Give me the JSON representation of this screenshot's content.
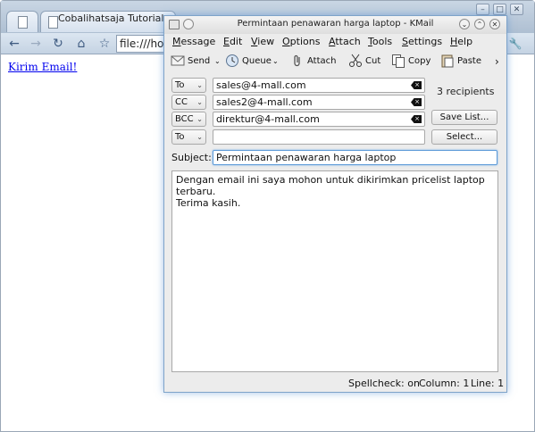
{
  "browser": {
    "tabs": [
      {
        "label": ""
      },
      {
        "label": "Cobalihatsaja Tutorial"
      }
    ],
    "url": "file:///hom",
    "page_link": "Kirim Email!"
  },
  "kmail": {
    "title": "Permintaan penawaran harga laptop - KMail",
    "menu": [
      "Message",
      "Edit",
      "View",
      "Options",
      "Attach",
      "Tools",
      "Settings",
      "Help"
    ],
    "toolbar": {
      "send": "Send",
      "queue": "Queue",
      "attach": "Attach",
      "cut": "Cut",
      "copy": "Copy",
      "paste": "Paste",
      "more": "›"
    },
    "recipients": [
      {
        "type": "To",
        "address": "sales@4-mall.com"
      },
      {
        "type": "CC",
        "address": "sales2@4-mall.com"
      },
      {
        "type": "BCC",
        "address": "direktur@4-mall.com"
      },
      {
        "type": "To",
        "address": ""
      }
    ],
    "recipients_count": "3 recipients",
    "save_list_label": "Save List...",
    "select_label": "Select...",
    "subject_label": "Subject:",
    "subject": "Permintaan penawaran harga laptop",
    "body_line1": "Dengan email ini saya mohon untuk dikirimkan pricelist laptop terbaru.",
    "body_line2": "Terima kasih.",
    "status": {
      "spellcheck": "Spellcheck: on",
      "column": "Column: 1",
      "line": "Line: 1"
    }
  }
}
